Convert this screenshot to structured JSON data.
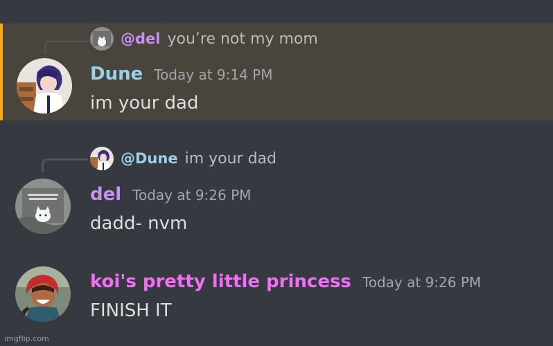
{
  "messages": [
    {
      "reply": {
        "mention": "@del",
        "text": "you’re not my mom"
      },
      "username": "Dune",
      "timestamp": "Today at 9:14 PM",
      "content": "im your dad"
    },
    {
      "reply": {
        "mention": "@Dune",
        "text": "im your dad"
      },
      "username": "del",
      "timestamp": "Today at 9:26 PM",
      "content": "dadd- nvm"
    },
    {
      "username": "koi's pretty little princess",
      "timestamp": "Today at 9:26 PM",
      "content": "FINISH IT"
    }
  ],
  "watermark": "imgflip.com",
  "colors": {
    "background": "#36393f",
    "highlight": "#49443c",
    "highlight_border": "#faa81a",
    "dune": "#99d1e8",
    "del": "#c890f0",
    "koi": "#f36ef6"
  }
}
